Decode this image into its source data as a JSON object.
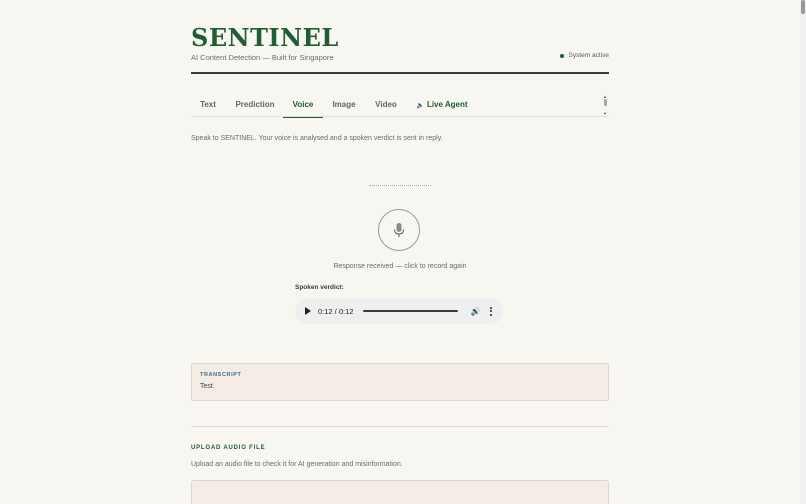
{
  "header": {
    "logo": "SENTINEL",
    "tagline": "AI Content Detection — Built for Singapore",
    "status": "System active",
    "status_color": "#1f5d34"
  },
  "tabs": [
    {
      "label": "Text",
      "active": false
    },
    {
      "label": "Prediction",
      "active": false
    },
    {
      "label": "Voice",
      "active": true
    },
    {
      "label": "Image",
      "active": false
    },
    {
      "label": "Video",
      "active": false
    },
    {
      "label": "Live Agent",
      "active": false,
      "icon": "speaker-icon"
    }
  ],
  "voice": {
    "intro": "Speak to SENTINEL. Your voice is analysed and a spoken verdict is sent in reply.",
    "mic_icon": "microphone-icon",
    "mic_status": "Response received — click to record again",
    "verdict_label": "Spoken verdict:",
    "audio": {
      "time": "0:12 / 0:12",
      "progress": 1.0
    }
  },
  "transcript": {
    "heading": "TRANSCRIPT",
    "text": "Test."
  },
  "upload": {
    "heading": "UPLOAD AUDIO FILE",
    "description": "Upload an audio file to check it for AI generation and misinformation."
  },
  "colors": {
    "brand": "#1f5d34",
    "background": "#f8f6f1",
    "panel": "#f3ede6",
    "transcript_heading": "#3f6a8f"
  }
}
